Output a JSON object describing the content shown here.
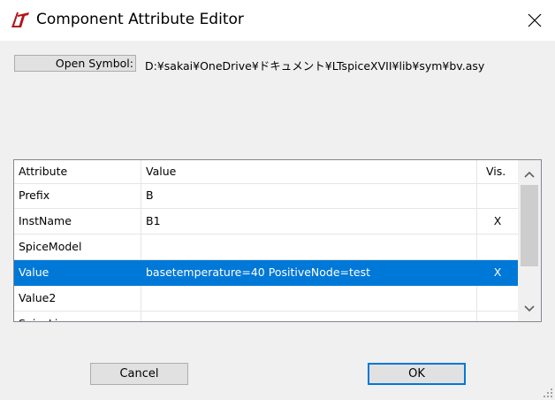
{
  "window": {
    "title": "Component Attribute Editor"
  },
  "open_symbol": {
    "button_label": "Open Symbol:",
    "path": "D:¥sakai¥OneDrive¥ドキュメント¥LTspiceXVII¥lib¥sym¥bv.asy"
  },
  "grid": {
    "headers": {
      "attribute": "Attribute",
      "value": "Value",
      "vis": "Vis."
    },
    "rows": [
      {
        "attribute": "Prefix",
        "value": "B",
        "vis": ""
      },
      {
        "attribute": "InstName",
        "value": "B1",
        "vis": "X"
      },
      {
        "attribute": "SpiceModel",
        "value": "",
        "vis": ""
      },
      {
        "attribute": "Value",
        "value": "basetemperature=40 PositiveNode=test",
        "vis": "X",
        "selected": true
      },
      {
        "attribute": "Value2",
        "value": "",
        "vis": ""
      },
      {
        "attribute": "SpiceLine",
        "value": "",
        "vis": ""
      }
    ]
  },
  "buttons": {
    "cancel": "Cancel",
    "ok": "OK"
  },
  "colors": {
    "selection": "#0078d7",
    "ok_border": "#0078d7"
  }
}
